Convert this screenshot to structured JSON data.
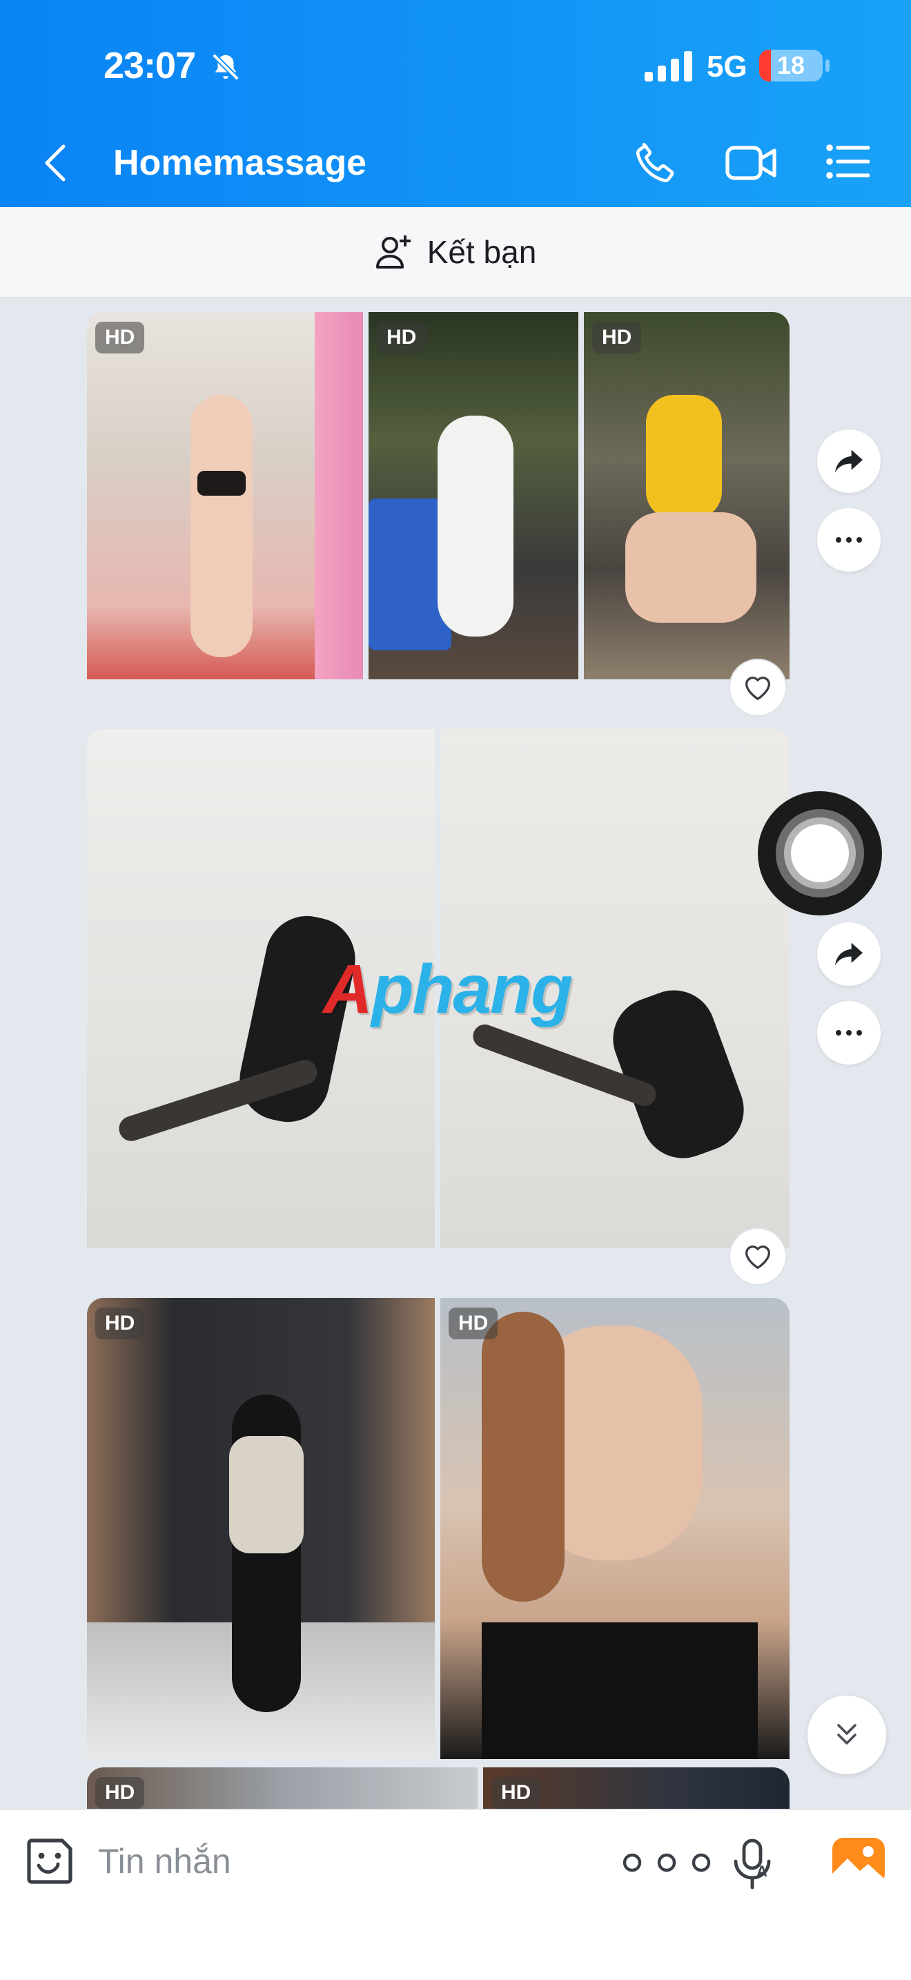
{
  "status_bar": {
    "time": "23:07",
    "network": "5G",
    "battery": "18",
    "battery_level": 0.18
  },
  "header": {
    "title": "Homemassage"
  },
  "friend_bar": {
    "label": "Kết bạn"
  },
  "messages": {
    "hd_label": "HD"
  },
  "watermark": {
    "first": "A",
    "rest": "phang"
  },
  "input": {
    "placeholder": "Tin nhắn"
  },
  "colors": {
    "header_start": "#0a83f5",
    "header_end": "#19a2f7",
    "chat_bg": "#e3e8ee",
    "battery_low": "#ff3b30"
  },
  "icons": [
    "bell-slash-icon",
    "signal-icon",
    "back-icon",
    "phone-icon",
    "video-camera-icon",
    "list-menu-icon",
    "add-friend-icon",
    "share-icon",
    "more-icon",
    "heart-icon",
    "chevron-double-down-icon",
    "sticker-icon",
    "dots-icon",
    "voice-to-text-icon",
    "gallery-icon"
  ]
}
